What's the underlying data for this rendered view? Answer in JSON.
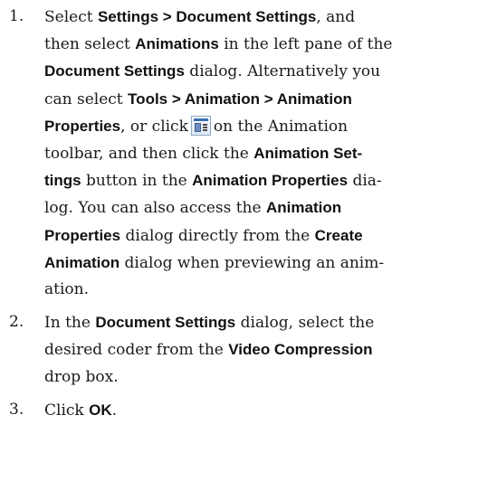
{
  "steps": [
    {
      "number": "1.",
      "l1": {
        "t1": "Select ",
        "b1": "Settings > Document Settings",
        "t2": ", and"
      },
      "l2": {
        "t1": "then select ",
        "b1": "Animations",
        "t2": " in the left pane of the"
      },
      "l3": {
        "b1": "Document Settings",
        "t1": " dialog. Alternatively you"
      },
      "l4": {
        "t1": "can select ",
        "b1": "Tools > Animation > Animation"
      },
      "l5": {
        "b1": "Properties",
        "t1": ", or click",
        "t2": "on the Animation"
      },
      "l6": {
        "t1": "toolbar, and then click the ",
        "b1": "Animation Set-"
      },
      "l7": {
        "b1": "tings",
        "t1": " button in the ",
        "b2": "Animation Properties",
        "t2": " dia-"
      },
      "l8": {
        "t1": "log. You can also access the ",
        "b1": "Animation"
      },
      "l9": {
        "b1": "Properties",
        "t1": " dialog directly from the ",
        "b2": "Create"
      },
      "l10": {
        "b1": "Animation",
        "t1": " dialog when previewing an anim-"
      },
      "l11": {
        "t1": "ation."
      }
    },
    {
      "number": "2.",
      "l1": {
        "t1": "In the ",
        "b1": "Document Settings",
        "t2": " dialog, select the"
      },
      "l2": {
        "t1": "desired coder from the ",
        "b1": "Video Compression"
      },
      "l3": {
        "t1": "drop box."
      }
    },
    {
      "number": "3.",
      "l1": {
        "t1": "Click ",
        "b1": "OK",
        "t2": "."
      }
    }
  ],
  "icons": {
    "animation_properties": "animation-properties-icon"
  }
}
